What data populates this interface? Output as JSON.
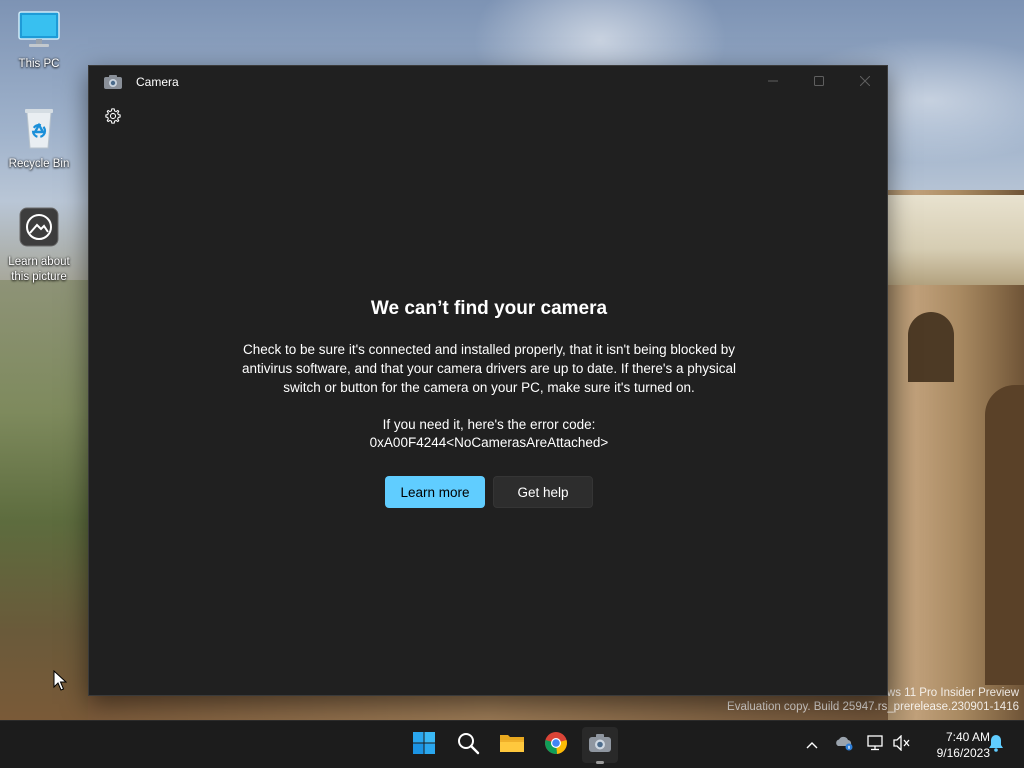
{
  "desktop": {
    "icons": [
      {
        "label": "This PC",
        "icon": "monitor-icon"
      },
      {
        "label": "Recycle Bin",
        "icon": "recycle-bin-icon"
      },
      {
        "label": "Learn about this picture",
        "icon": "learn-picture-icon"
      }
    ],
    "watermark": {
      "line1": "ws 11 Pro Insider Preview",
      "line2": "Evaluation copy. Build 25947.rs_prerelease.230901-1416"
    }
  },
  "window": {
    "title": "Camera",
    "app_icon": "camera-icon",
    "controls": [
      "minimize-icon",
      "maximize-icon",
      "close-icon"
    ],
    "settings_icon": "gear-icon",
    "error": {
      "title": "We can’t find your camera",
      "body": "Check to be sure it's connected and installed properly, that it isn't being blocked by antivirus software, and that your camera drivers are up to date. If there's a physical switch or button for the camera on your PC, make sure it's turned on.",
      "code_label": "If you need it, here's the error code:",
      "code": "0xA00F4244<NoCamerasAreAttached>"
    },
    "buttons": {
      "learn_more": "Learn more",
      "get_help": "Get help"
    }
  },
  "taskbar": {
    "apps": [
      "windows-start-icon",
      "search-icon",
      "file-explorer-icon",
      "chrome-icon",
      "camera-icon"
    ],
    "tray": [
      "chevron-up-icon",
      "onedrive-icon",
      "network-icon",
      "volume-muted-icon",
      "notification-bell-icon"
    ],
    "clock": {
      "time": "7:40 AM",
      "date": "9/16/2023"
    }
  },
  "colors": {
    "accent": "#60cdff",
    "window_bg": "#202020",
    "taskbar_bg": "#1c1c1c"
  }
}
